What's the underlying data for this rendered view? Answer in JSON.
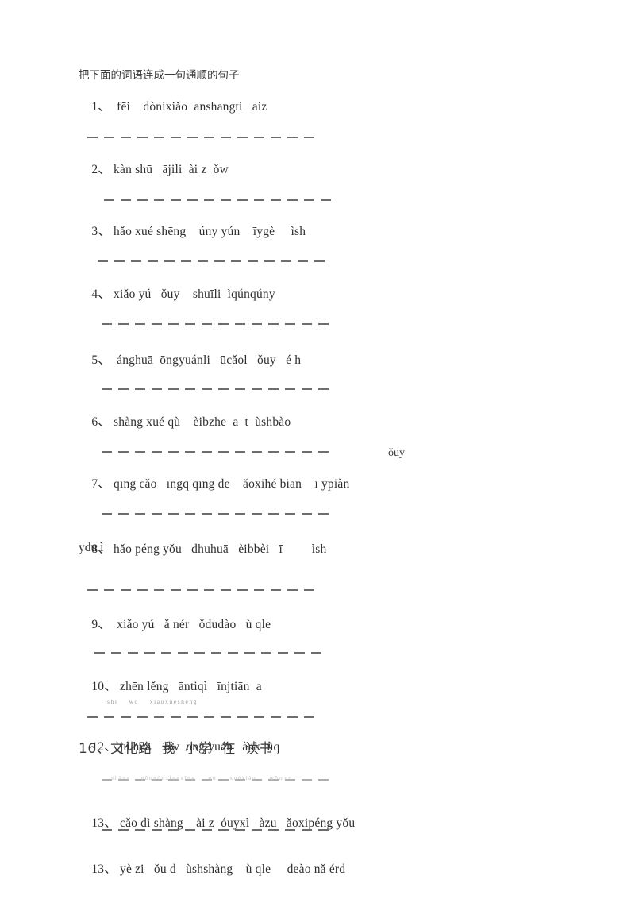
{
  "document": {
    "heading": "把下面的词语连成一句通顺的句子",
    "questions": [
      {
        "number": "1、",
        "text": "  fēi    dònixiǎo  anshangti   aiz"
      },
      {
        "number": "2、",
        "text": " kàn shū   ājili  ài z  ǒw"
      },
      {
        "number": "3、",
        "text": " hǎo xué shēng    úny yún    īygè     ìsh"
      },
      {
        "number": "4、",
        "text": " xiǎo yú   ǒuy    shuīli  ìqúnqúny"
      },
      {
        "number": "5、",
        "text": "  ánghuā  ōngyuánli   ūcǎol   ǒuy   é h"
      },
      {
        "number": "6、",
        "text": " shàng xué qù    èibzhe  a  t  ùshbào"
      },
      {
        "number": "7、",
        "text": " qīng cǎo   īngq qīng de    ǎoxihé biān    ī ypiàn"
      },
      {
        "number": "8、",
        "text": " hǎo péng yǒu   dhuhuā   èibbèi   ī         ìsh"
      },
      {
        "number": "9、",
        "text": "  xiǎo yú   ǎ nér   ǒdudào   ù qle"
      },
      {
        "number": "10、",
        "text": " zhēn lěng   āntiqì   īnjtiān  a"
      },
      {
        "number": "12、",
        "text": " jú huā    ǒw  ōng yuán   ànk  ùq"
      },
      {
        "number": "13、",
        "text": " cǎo dì shàng    ài z  óuyxì   àzu   ǎoxipéng yǒu"
      },
      {
        "number": "13、",
        "text": " yè zi   ǒu d   ùshshàng    ù qle     deào nǎ érd"
      }
    ],
    "continuations": [
      {
        "id": "q8-wrap",
        "text": "ydu ì"
      }
    ],
    "floating_fragments": [
      {
        "id": "q7-stray",
        "text": "ǒuy"
      }
    ],
    "annotations": {
      "tiny_pinyin_line": "shi    wǒ    xiǎoxuéshēng",
      "faded_pinyin_line": "shàng    gōugōuxīngxīng     qù     xuéxiào     wǒmen",
      "hanzi_answer_line": "16、文化路  我  小学  在  读书"
    }
  }
}
